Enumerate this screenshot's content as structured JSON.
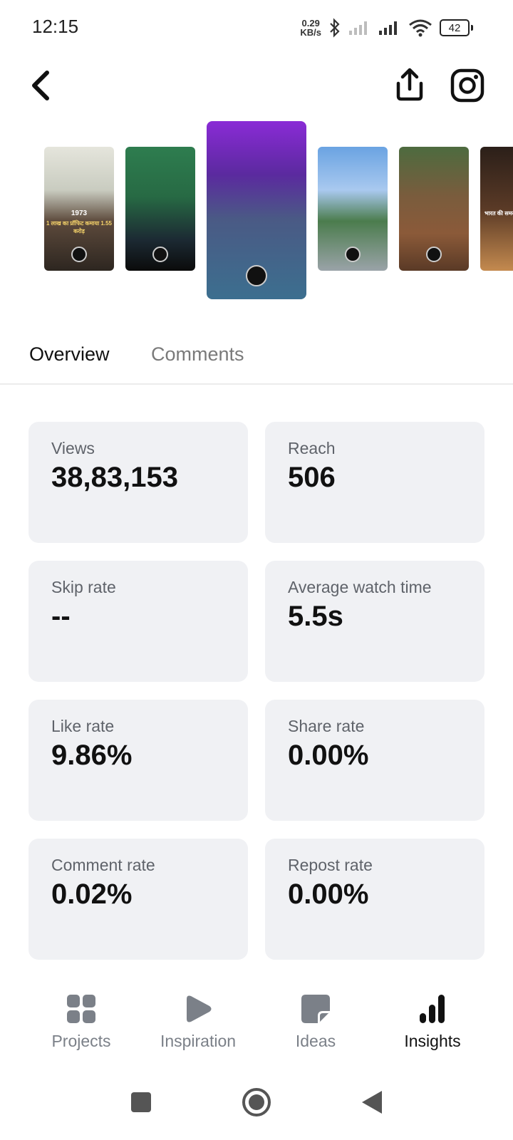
{
  "status_bar": {
    "time": "12:15",
    "net_speed_value": "0.29",
    "net_speed_unit": "KB/s",
    "battery": "42",
    "icons": [
      "bluetooth-icon",
      "signal-weak-icon",
      "signal-icon",
      "wifi-icon",
      "battery-icon"
    ]
  },
  "header": {
    "back_icon": "chevron-left-icon",
    "share_icon": "share-upload-icon",
    "platform_icon": "instagram-icon"
  },
  "carousel": {
    "thumbnails": [
      {
        "caption_top": "1973",
        "caption_sub": "1 लाख का प्रॉफिट कमाया 1.55 करोड़"
      },
      {
        "caption_top": "",
        "caption_sub": ""
      },
      {
        "caption_top": "",
        "caption_sub": ""
      },
      {
        "caption_top": "",
        "caption_sub": ""
      },
      {
        "caption_top": "",
        "caption_sub": ""
      },
      {
        "caption_top": "भारत की समस्",
        "caption_sub": ""
      }
    ]
  },
  "tabs": [
    {
      "label": "Overview",
      "active": true
    },
    {
      "label": "Comments",
      "active": false
    }
  ],
  "metrics": [
    {
      "label": "Views",
      "value": "38,83,153"
    },
    {
      "label": "Reach",
      "value": "506"
    },
    {
      "label": "Skip rate",
      "value": "--"
    },
    {
      "label": "Average watch time",
      "value": "5.5s"
    },
    {
      "label": "Like rate",
      "value": "9.86%"
    },
    {
      "label": "Share rate",
      "value": "0.00%"
    },
    {
      "label": "Comment rate",
      "value": "0.02%"
    },
    {
      "label": "Repost rate",
      "value": "0.00%"
    }
  ],
  "bottom_nav": [
    {
      "label": "Projects",
      "icon": "grid-icon",
      "active": false
    },
    {
      "label": "Inspiration",
      "icon": "play-icon",
      "active": false
    },
    {
      "label": "Ideas",
      "icon": "note-icon",
      "active": false
    },
    {
      "label": "Insights",
      "icon": "bar-chart-icon",
      "active": true
    }
  ],
  "colors": {
    "card_bg": "#f0f1f4",
    "label_gray": "#5f636a",
    "inactive_nav": "#7b8088",
    "active": "#111111"
  }
}
